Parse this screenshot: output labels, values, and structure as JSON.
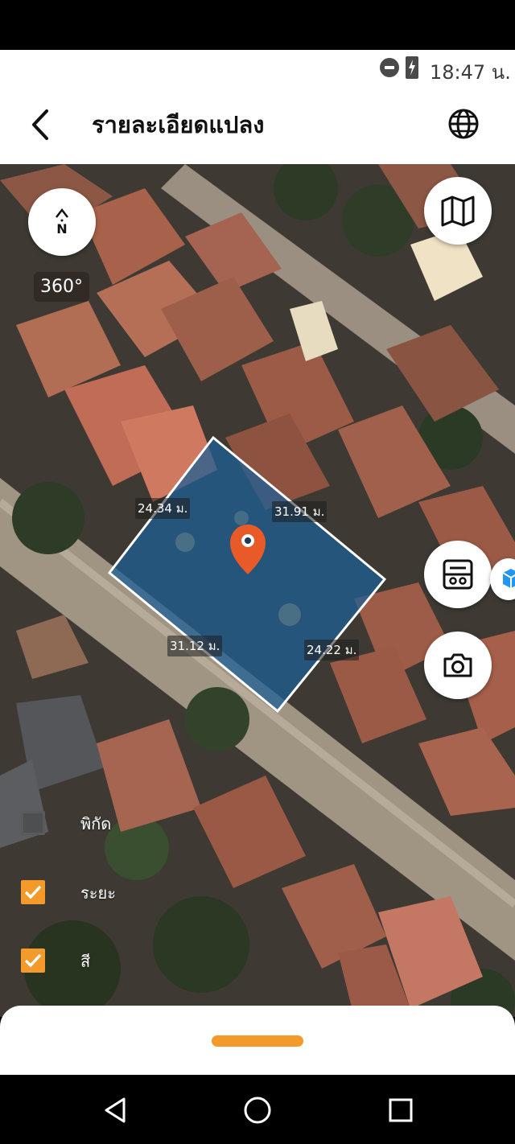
{
  "status_bar": {
    "time": "18:47 น.",
    "icons": [
      "do-not-disturb-icon",
      "battery-charging-icon"
    ]
  },
  "header": {
    "title": "รายละเอียดแปลง",
    "back_icon": "chevron-left-icon",
    "globe_icon": "globe-icon"
  },
  "map": {
    "compass_label": "N",
    "view_360_label": "360°",
    "parcel_color": "#1f5f96",
    "pin_color": "#e85a28",
    "distances": {
      "northwest": "24.34 ม.",
      "northeast": "31.91 ม.",
      "southwest": "31.12 ม.",
      "southeast": "24.22 ม."
    }
  },
  "side_buttons": {
    "layer_icon": "map-icon",
    "calculator_icon": "calculator-icon",
    "camera_icon": "camera-icon",
    "cube_icon": "cube-icon"
  },
  "layers": [
    {
      "label": "พิกัด",
      "checked": false
    },
    {
      "label": "ระยะ",
      "checked": true
    },
    {
      "label": "สี",
      "checked": true
    }
  ],
  "accent_color": "#f39a2b",
  "nav": [
    "back-triangle-icon",
    "home-circle-icon",
    "recents-square-icon"
  ]
}
